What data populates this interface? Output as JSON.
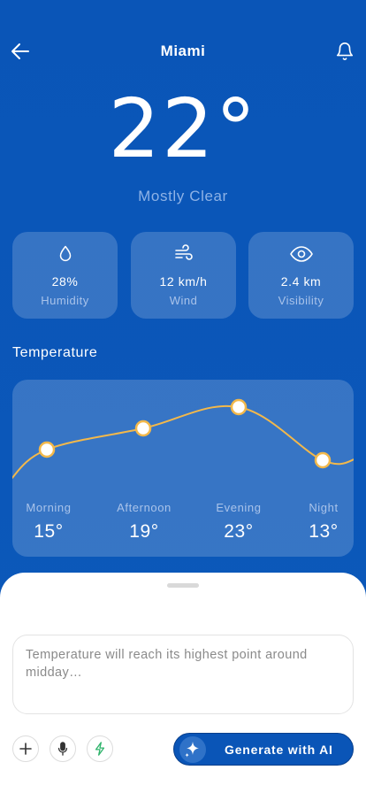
{
  "header": {
    "city": "Miami",
    "back_icon": "arrow-left-icon",
    "bell_icon": "bell-icon"
  },
  "current": {
    "temperature": "22°",
    "condition": "Mostly Clear"
  },
  "stats": [
    {
      "icon": "droplet-icon",
      "value": "28%",
      "label": "Humidity"
    },
    {
      "icon": "wind-icon",
      "value": "12 km/h",
      "label": "Wind"
    },
    {
      "icon": "eye-icon",
      "value": "2.4 km",
      "label": "Visibility"
    }
  ],
  "temperature_section": {
    "title": "Temperature",
    "periods": [
      {
        "label": "Morning",
        "temp": "15°"
      },
      {
        "label": "Afternoon",
        "temp": "19°"
      },
      {
        "label": "Evening",
        "temp": "23°"
      },
      {
        "label": "Night",
        "temp": "13°"
      }
    ]
  },
  "chart_data": {
    "type": "line",
    "categories": [
      "Morning",
      "Afternoon",
      "Evening",
      "Night"
    ],
    "values": [
      15,
      19,
      23,
      13
    ],
    "color": "#f2b84b"
  },
  "composer": {
    "placeholder": "Temperature will reach its highest point around midday…",
    "tools": [
      "plus-icon",
      "microphone-icon",
      "lightning-icon"
    ],
    "generate_label": "Generate with AI",
    "generate_icon": "sparkle-icon"
  },
  "colors": {
    "background": "#0a55b7",
    "accent": "#f2b84b",
    "lightning": "#2fb36b"
  }
}
